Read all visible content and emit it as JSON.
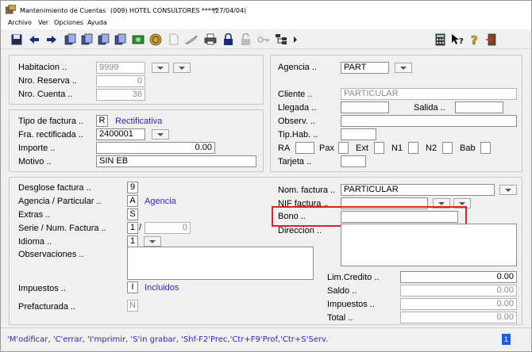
{
  "window": {
    "title": "Mantenimiento de Cuentas",
    "company": "(009) HOTEL CONSULTORES *****",
    "date": "(27/04/04)"
  },
  "menu": [
    "Archivo",
    "Ver",
    "Opciones",
    "Ayuda"
  ],
  "colors": {
    "accent_text": "#2b2bb8",
    "highlight": "#d42626"
  },
  "reservation": {
    "habitacion_label": "Habitacion ..",
    "habitacion_value": "9999",
    "nro_reserva_label": "Nro. Reserva ..",
    "nro_reserva_value": "0",
    "nro_cuenta_label": "Nro. Cuenta ..",
    "nro_cuenta_value": "36"
  },
  "invoice": {
    "tipo_label": "Tipo de factura ..",
    "tipo_code": "R",
    "tipo_desc": "Rectificativa",
    "fra_label": "Fra. rectificada ..",
    "fra_value": "2400001",
    "importe_label": "Importe ..",
    "importe_value": "0.00",
    "motivo_label": "Motivo ..",
    "motivo_value": "SIN EB"
  },
  "client": {
    "agencia_label": "Agencia ..",
    "agencia_value": "PART",
    "cliente_label": "Cliente ..",
    "cliente_value": "PARTICULAR",
    "llegada_label": "Llegada ..",
    "salida_label": "Salida ..",
    "observ_label": "Observ. ..",
    "tiphab_label": "Tip.Hab. ..",
    "ra_label": "RA",
    "pax_label": "Pax",
    "ext_label": "Ext",
    "n1_label": "N1",
    "n2_label": "N2",
    "bab_label": "Bab",
    "tarjeta_label": "Tarjeta .."
  },
  "billing": {
    "desglose_label": "Desglose factura ..",
    "desglose_value": "9",
    "agpart_label": "Agencia / Particular ..",
    "agpart_code": "A",
    "agpart_desc": "Agencia",
    "extras_label": "Extras ..",
    "extras_value": "S",
    "serie_label": "Serie / Num. Factura ..",
    "serie_value": "1",
    "serie_sep": "/",
    "num_value": "0",
    "idioma_label": "Idioma ..",
    "idioma_value": "1",
    "obs_label": "Observaciones ..",
    "impuestos_label": "Impuestos ..",
    "impuestos_code": "I",
    "impuestos_desc": "Incluidos",
    "prefacturada_label": "Prefacturada ..",
    "prefacturada_value": "N"
  },
  "invoicee": {
    "nom_label": "Nom. factura ..",
    "nom_value": "PARTICULAR",
    "nif_label": "NIF factura ..",
    "bono_label": "Bono ..",
    "direccion_label": "Direccion .."
  },
  "totals": {
    "limcredito_label": "Lim.Credito ..",
    "limcredito_value": "0.00",
    "saldo_label": "Saldo ..",
    "saldo_value": "0.00",
    "impuestos_label": "Impuestos ..",
    "impuestos_value": "0.00",
    "total_label": "Total ..",
    "total_value": "0.00"
  },
  "status": {
    "text": "'M'odificar, 'C'errar, 'I'mprimir, 'S'in grabar, 'Shf-F2'Prec,'Ctr+F9'Prof,'Ctr+S'Serv.",
    "page": "1"
  },
  "toolbar_icons": [
    "save-icon",
    "arrow-left-icon",
    "arrow-right-icon",
    "doc-icon-1",
    "doc-icon-2",
    "doc-icon-3",
    "doc-icon-4",
    "money-icon",
    "euro-icon",
    "page-icon",
    "feather-icon",
    "printer-icon",
    "lock-closed-icon",
    "lock-open-icon",
    "key-icon",
    "tree-icon",
    "more-arrow-icon",
    "calculator-icon",
    "context-help-icon",
    "question-icon",
    "exit-icon"
  ]
}
